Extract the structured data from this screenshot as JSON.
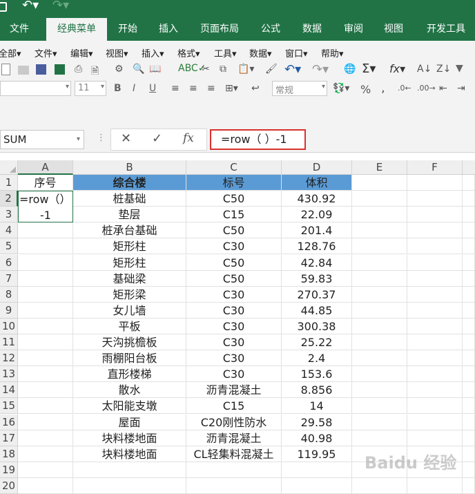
{
  "tabs": [
    "文件",
    "经典菜单",
    "开始",
    "插入",
    "页面布局",
    "公式",
    "数据",
    "审阅",
    "视图",
    "开发工具"
  ],
  "active_tab": "经典菜单",
  "menus": [
    "全部▾",
    "文件▾",
    "编辑▾",
    "视图▾",
    "插入▾",
    "格式▾",
    "工具▾",
    "数据▾",
    "窗口▾",
    "帮助▾"
  ],
  "toolbar": {
    "font_size": "11",
    "bold": "B",
    "italic": "I",
    "underline": "U",
    "number_format": "常规",
    "percent": "%",
    "comma": ","
  },
  "formula_bar": {
    "name_box": "SUM",
    "cancel": "✕",
    "enter": "✓",
    "fx": "fx",
    "formula": "=row（ ）-1"
  },
  "columns": [
    "A",
    "B",
    "C",
    "D",
    "E",
    "F"
  ],
  "rows": [
    "1",
    "2",
    "3",
    "4",
    "5",
    "6",
    "7",
    "8",
    "9",
    "10",
    "11",
    "12",
    "13",
    "14",
    "15",
    "16",
    "17",
    "18",
    "19",
    "20"
  ],
  "header_row": {
    "a": "序号",
    "b": "综合楼",
    "c": "标号",
    "d": "体积"
  },
  "edit_cell": {
    "line1": "=row（）",
    "line2": "-1"
  },
  "data_rows": [
    {
      "b": "桩基础",
      "c": "C50",
      "d": "430.92"
    },
    {
      "b": "垫层",
      "c": "C15",
      "d": "22.09"
    },
    {
      "b": "桩承台基础",
      "c": "C50",
      "d": "201.4"
    },
    {
      "b": "矩形柱",
      "c": "C30",
      "d": "128.76"
    },
    {
      "b": "矩形柱",
      "c": "C50",
      "d": "42.84"
    },
    {
      "b": "基础梁",
      "c": "C50",
      "d": "59.83"
    },
    {
      "b": "矩形梁",
      "c": "C30",
      "d": "270.37"
    },
    {
      "b": "女儿墙",
      "c": "C30",
      "d": "44.85"
    },
    {
      "b": "平板",
      "c": "C30",
      "d": "300.38"
    },
    {
      "b": "天沟挑檐板",
      "c": "C30",
      "d": "25.22"
    },
    {
      "b": "雨棚阳台板",
      "c": "C30",
      "d": "2.4"
    },
    {
      "b": "直形楼梯",
      "c": "C30",
      "d": "153.6"
    },
    {
      "b": "散水",
      "c": "沥青混凝土",
      "d": "8.856"
    },
    {
      "b": "太阳能支墩",
      "c": "C15",
      "d": "14"
    },
    {
      "b": "屋面",
      "c": "C20刚性防水",
      "d": "29.58"
    },
    {
      "b": "块料楼地面",
      "c": "沥青混凝土",
      "d": "40.98"
    },
    {
      "b": "块料楼地面",
      "c": "CL轻集料混凝土",
      "d": "119.95"
    }
  ],
  "watermark": "Baidu 经验",
  "colors": {
    "ribbon_green": "#217346",
    "header_blue": "#5b9bd5",
    "highlight_red": "#d9312c"
  }
}
